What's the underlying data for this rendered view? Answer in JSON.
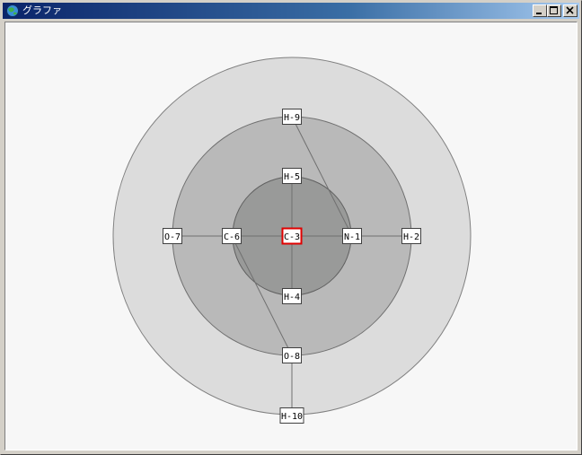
{
  "window": {
    "title": "グラファ",
    "icon": "app-globe-icon",
    "controls": [
      "minimize-icon",
      "maximize-icon",
      "close-icon"
    ]
  },
  "graph": {
    "selected_node": "C-3",
    "colors": {
      "ring_outer": "#dcdcdc",
      "ring_middle": "#b9b9b9",
      "ring_inner": "#999a99",
      "edge": "#707070",
      "node_border": "#404040",
      "selected_border": "#e00000",
      "background": "#f7f7f7"
    },
    "nodes": [
      {
        "id": "C-3",
        "label": "C-3"
      },
      {
        "id": "H-9",
        "label": "H-9"
      },
      {
        "id": "H-5",
        "label": "H-5"
      },
      {
        "id": "N-1",
        "label": "N-1"
      },
      {
        "id": "H-2",
        "label": "H-2"
      },
      {
        "id": "O-7",
        "label": "O-7"
      },
      {
        "id": "C-6",
        "label": "C-6"
      },
      {
        "id": "H-4",
        "label": "H-4"
      },
      {
        "id": "O-8",
        "label": "O-8"
      },
      {
        "id": "H-10",
        "label": "H-10"
      }
    ],
    "edges": [
      [
        "C-3",
        "H-5"
      ],
      [
        "C-3",
        "N-1"
      ],
      [
        "C-3",
        "C-6"
      ],
      [
        "C-3",
        "H-4"
      ],
      [
        "N-1",
        "H-2"
      ],
      [
        "N-1",
        "H-9"
      ],
      [
        "C-6",
        "O-7"
      ],
      [
        "C-6",
        "O-8"
      ],
      [
        "O-8",
        "H-10"
      ]
    ]
  }
}
